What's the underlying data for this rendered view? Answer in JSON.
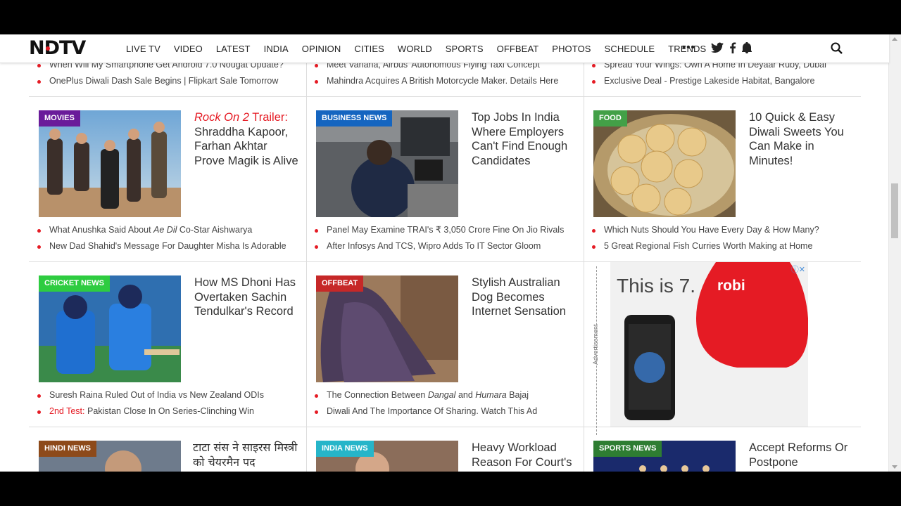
{
  "nav": {
    "logo": "NDTV",
    "links": [
      "LIVE TV",
      "VIDEO",
      "LATEST",
      "INDIA",
      "OPINION",
      "CITIES",
      "WORLD",
      "SPORTS",
      "OFFBEAT",
      "PHOTOS",
      "SCHEDULE",
      "TRENDS"
    ],
    "more": "•••",
    "icons": [
      "twitter-icon",
      "facebook-icon",
      "notification-bell-icon",
      "search-icon"
    ]
  },
  "top_lists": {
    "col1": [
      "When Will My Smartphone Get Android 7.0 Nougat Update?",
      "OnePlus Diwali Dash Sale Begins | Flipkart Sale Tomorrow"
    ],
    "col2": [
      "Meet Vahana, Airbus' Autonomous Flying Taxi Concept",
      "Mahindra Acquires A British Motorcycle Maker. Details Here"
    ],
    "col3": [
      "Spread Your Wings: Own A Home In Deyaar Ruby, Dubai",
      "Exclusive Deal - Prestige Lakeside Habitat, Bangalore"
    ]
  },
  "cards": {
    "movies": {
      "badge": "MOVIES",
      "badge_color": "#6a1b9a",
      "headline_red": "Rock On 2",
      "headline_red_suffix": " Trailer:",
      "headline": "Shraddha Kapoor, Farhan Akhtar Prove Magik is Alive",
      "bullets": [
        "What Anushka Said About ",
        "Ae Dil",
        " Co-Star Aishwarya",
        "New Dad Shahid's Message For Daughter Misha Is Adorable"
      ]
    },
    "business": {
      "badge": "BUSINESS NEWS",
      "badge_color": "#1565c0",
      "headline": "Top Jobs In India Where Employers Can't Find Enough Candidates",
      "bullets": [
        "Panel May Examine TRAI's ₹ 3,050 Crore Fine On Jio Rivals",
        "After Infosys And TCS, Wipro Adds To IT Sector Gloom"
      ]
    },
    "food": {
      "badge": "FOOD",
      "badge_color": "#43a047",
      "headline": "10 Quick & Easy Diwali Sweets You Can Make in Minutes!",
      "bullets": [
        "Which Nuts Should You Have Every Day & How Many?",
        "5 Great Regional Fish Curries Worth Making at Home"
      ]
    },
    "cricket": {
      "badge": "CRICKET NEWS",
      "badge_color": "#2ecc40",
      "headline": "How MS Dhoni Has Overtaken Sachin Tendulkar's Record",
      "bullets": [
        "Suresh Raina Ruled Out of India vs New Zealand ODIs",
        "2nd Test:",
        " Pakistan Close In On Series-Clinching Win"
      ]
    },
    "offbeat": {
      "badge": "OFFBEAT",
      "badge_color": "#c62828",
      "headline": "Stylish Australian Dog Becomes Internet Sensation",
      "bullets": [
        "The Connection Between ",
        "Dangal",
        " and ",
        "Humara",
        " Bajaj",
        "Diwali And The Importance Of Sharing. Watch This Ad"
      ]
    },
    "hindi": {
      "badge": "HINDI NEWS",
      "badge_color": "#8d4a1a",
      "headline": "टाटा संस ने साइरस मिस्त्री को चेयरमैन पद"
    },
    "india": {
      "badge": "INDIA NEWS",
      "badge_color": "#26b5c9",
      "headline": "Heavy Workload Reason For Court's"
    },
    "sports": {
      "badge": "SPORTS NEWS",
      "badge_color": "#2e7d32",
      "headline": "Accept Reforms Or Postpone"
    }
  },
  "ad": {
    "label": "Advertisement",
    "text": "This is 7.",
    "brand": "robi",
    "info": "ⓘ✕"
  }
}
